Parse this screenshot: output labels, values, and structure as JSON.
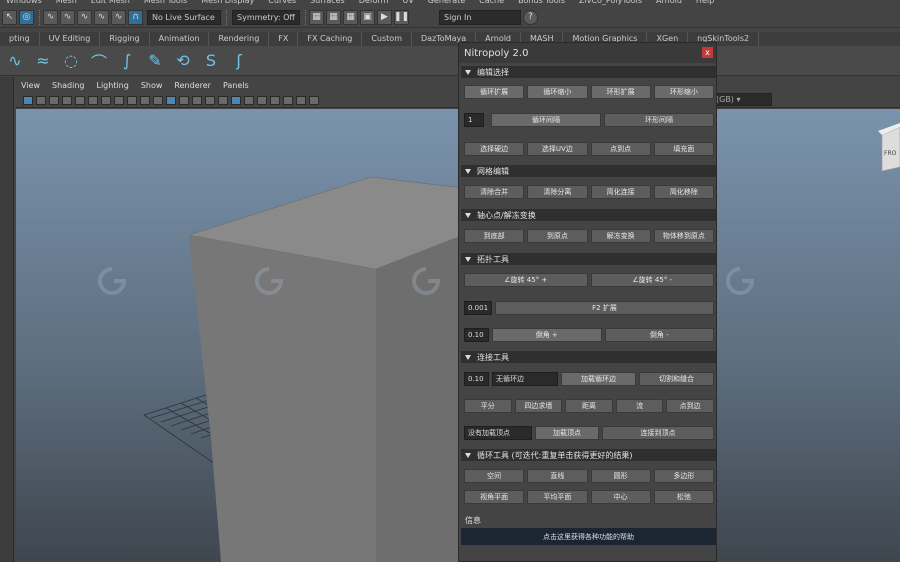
{
  "menubar": [
    "Windows",
    "Mesh",
    "Edit Mesh",
    "Mesh Tools",
    "Mesh Display",
    "Curves",
    "Surfaces",
    "Deform",
    "UV",
    "Generate",
    "Cache",
    "Bonus Tools",
    "ZivCo_PolyTools",
    "Arnold",
    "Help"
  ],
  "statusline": {
    "live_surface": "No Live Surface",
    "symmetry": "Symmetry: Off",
    "sign_in": "Sign In"
  },
  "shelf_tabs": [
    "pting",
    "UV Editing",
    "Rigging",
    "Animation",
    "Rendering",
    "FX",
    "FX Caching",
    "Custom",
    "DazToMaya",
    "Arnold",
    "MASH",
    "Motion Graphics",
    "XGen",
    "ngSkinTools2"
  ],
  "viewport": {
    "menu": [
      "View",
      "Shading",
      "Lighting",
      "Show",
      "Renderer",
      "Panels"
    ],
    "color_space": "(GB)",
    "viewcube_label": "FRO"
  },
  "nitropoly": {
    "title": "Nitropoly 2.0",
    "close": "x",
    "sections": {
      "select": "编辑选择",
      "mesh_edit": "网格编辑",
      "pivot": "轴心点/解冻变换",
      "topology": "拓扑工具",
      "connect": "连接工具",
      "loop": "循环工具 (可迭代:重复单击获得更好的结果)",
      "info": "信息"
    },
    "select_row1": [
      "循环扩展",
      "循环缩小",
      "环形扩展",
      "环形缩小"
    ],
    "interval_value": "1",
    "select_row2": [
      "循环间隔",
      "环形间隔"
    ],
    "select_row3": [
      "选择硬边",
      "选择UV边",
      "点到点",
      "填充面"
    ],
    "mesh_row": [
      "清除合并",
      "清除分离",
      "简化连接",
      "简化移除"
    ],
    "pivot_row": [
      "到底部",
      "到原点",
      "解冻变换",
      "物体移到原点"
    ],
    "rotate_row": [
      "∠旋转 45° +",
      "∠旋转 45° -"
    ],
    "f2_value": "0.001",
    "f2_label": "F2 扩展",
    "bevel_value": "0.10",
    "bevel_row": [
      "倒角 +",
      "倒角 -"
    ],
    "connect_value": "0.10",
    "connect_mode": "无循环边",
    "connect_row1": [
      "加载循环边",
      "切割和缝合"
    ],
    "connect_row2": [
      "平分",
      "四边求墙",
      "距离",
      "流",
      "点到边"
    ],
    "vertex_field": "没有加载顶点",
    "vertex_row": [
      "加载顶点",
      "连接到顶点"
    ],
    "loop_row1": [
      "空间",
      "直线",
      "圆形",
      "多边形"
    ],
    "loop_row2": [
      "视角平面",
      "平均平面",
      "中心",
      "松弛"
    ],
    "info_text": "点击这里获得各种功能的帮助"
  },
  "watermark": "G"
}
